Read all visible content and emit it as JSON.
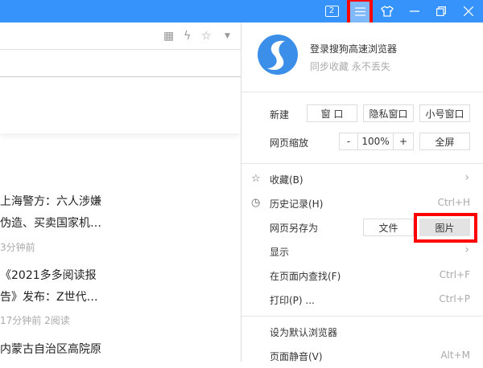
{
  "titlebar": {
    "tab_count": "2"
  },
  "login": {
    "title": "登录搜狗高速浏览器",
    "subtitle": "同步收藏 永不丢失"
  },
  "new_row": {
    "label": "新建",
    "buttons": [
      "窗 口",
      "隐私窗口",
      "小号窗口"
    ]
  },
  "zoom_row": {
    "label": "网页缩放",
    "minus": "-",
    "value": "100%",
    "plus": "+",
    "fullscreen": "全屏"
  },
  "menu": [
    {
      "label": "收藏(B)",
      "icon": "star-icon",
      "shortcut": "",
      "submenu": true
    },
    {
      "label": "历史记录(H)",
      "icon": "clock-icon",
      "shortcut": "Ctrl+H"
    },
    {
      "label": "网页另存为",
      "buttons": [
        "文件",
        "图片"
      ]
    },
    {
      "label": "显示",
      "submenu": true
    },
    {
      "label": "在页面内查找(F)",
      "shortcut": "Ctrl+F"
    },
    {
      "label": "打印(P) ...",
      "shortcut": "Ctrl+P"
    },
    {
      "label": "设为默认浏览器"
    },
    {
      "label": "页面静音(V)",
      "shortcut": "Alt+M"
    }
  ],
  "news": [
    {
      "line1": "上海警方：六人涉嫌",
      "line2": "伪造、买卖国家机…",
      "meta": "3分钟前"
    },
    {
      "line1": "《2021多多阅读报",
      "line2": "告》发布：Z世代…",
      "meta": "17分钟前   2阅读"
    },
    {
      "line1": "内蒙古自治区高院原"
    }
  ]
}
